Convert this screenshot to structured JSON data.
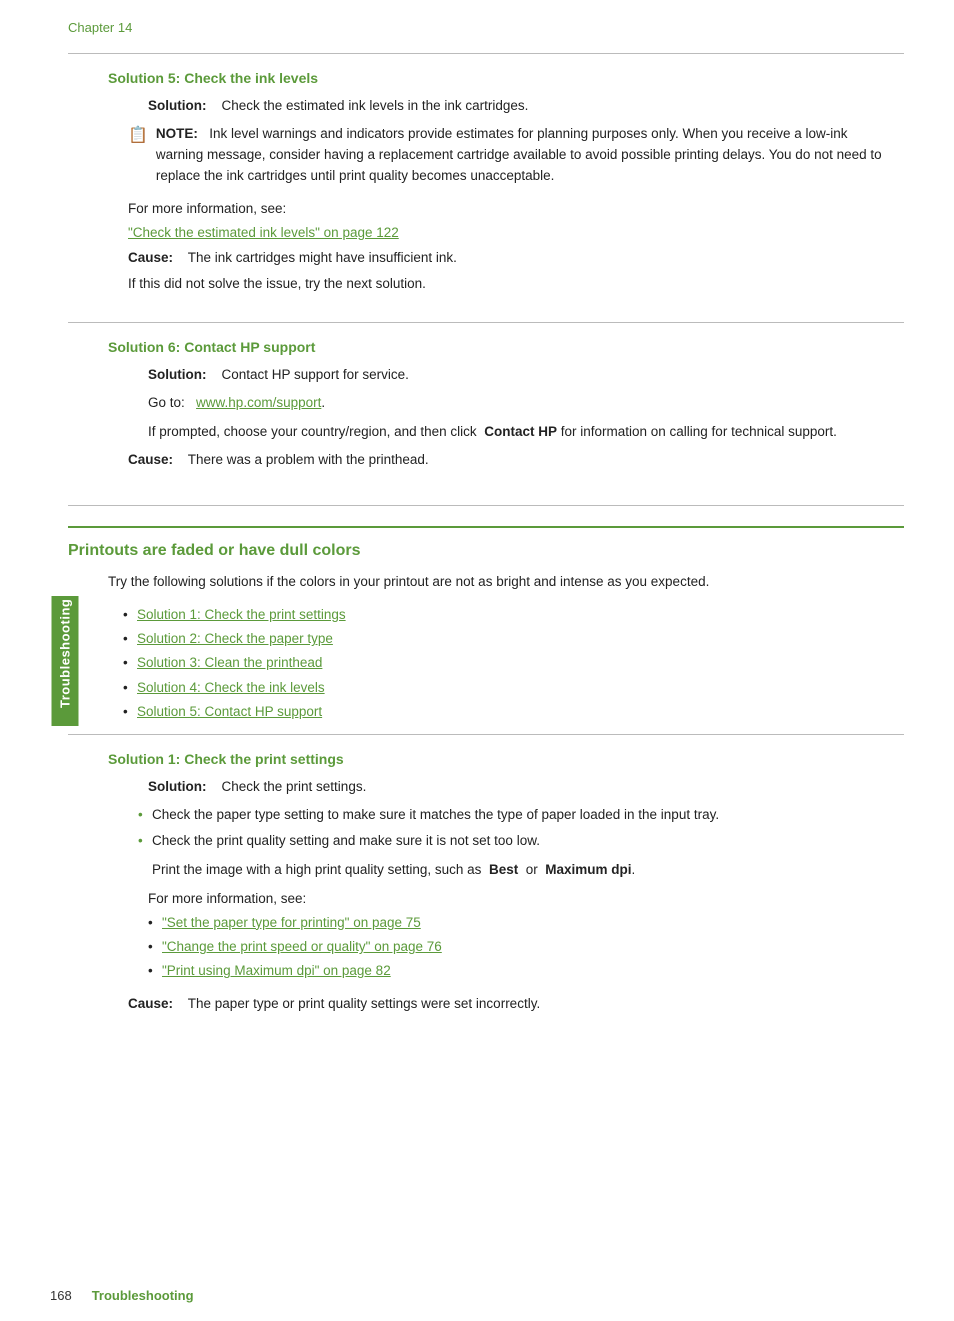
{
  "chapter_label": "Chapter 14",
  "side_tab": "Troubleshooting",
  "section5": {
    "heading": "Solution 5: Check the ink levels",
    "solution_label": "Solution:",
    "solution_text": "Check the estimated ink levels in the ink cartridges.",
    "note_label": "NOTE:",
    "note_text": "Ink level warnings and indicators provide estimates for planning purposes only. When you receive a low-ink warning message, consider having a replacement cartridge available to avoid possible printing delays. You do not need to replace the ink cartridges until print quality becomes unacceptable.",
    "for_more": "For more information, see:",
    "link": "\"Check the estimated ink levels\" on page 122",
    "cause_label": "Cause:",
    "cause_text": "The ink cartridges might have insufficient ink.",
    "if_not_solve": "If this did not solve the issue, try the next solution."
  },
  "section6": {
    "heading": "Solution 6: Contact HP support",
    "solution_label": "Solution:",
    "solution_text": "Contact HP support for service.",
    "go_to": "Go to:",
    "link": "www.hp.com/support",
    "if_prompted": "If prompted, choose your country/region, and then click",
    "contact_hp_bold": "Contact HP",
    "for_info": "for information on calling for technical support.",
    "cause_label": "Cause:",
    "cause_text": "There was a problem with the printhead."
  },
  "main_section": {
    "heading": "Printouts are faded or have dull colors",
    "intro": "Try the following solutions if the colors in your printout are not as bright and intense as you expected.",
    "solutions_list": [
      "Solution 1: Check the print settings",
      "Solution 2: Check the paper type",
      "Solution 3: Clean the printhead",
      "Solution 4: Check the ink levels",
      "Solution 5: Contact HP support"
    ],
    "solution1": {
      "heading": "Solution 1: Check the print settings",
      "solution_label": "Solution:",
      "solution_text": "Check the print settings.",
      "bullets": [
        "Check the paper type setting to make sure it matches the type of paper loaded in the input tray.",
        "Check the print quality setting and make sure it is not set too low."
      ],
      "print_note": "Print the image with a high print quality setting, such as",
      "best_bold": "Best",
      "or_text": "or",
      "max_dpi_bold": "Maximum dpi",
      "print_end": ".",
      "for_more": "For more information, see:",
      "links": [
        "\"Set the paper type for printing\" on page 75",
        "\"Change the print speed or quality\" on page 76",
        "\"Print using Maximum dpi\" on page 82"
      ],
      "cause_label": "Cause:",
      "cause_text": "The paper type or print quality settings were set incorrectly."
    }
  },
  "footer": {
    "page_number": "168",
    "chapter_label": "Troubleshooting"
  }
}
